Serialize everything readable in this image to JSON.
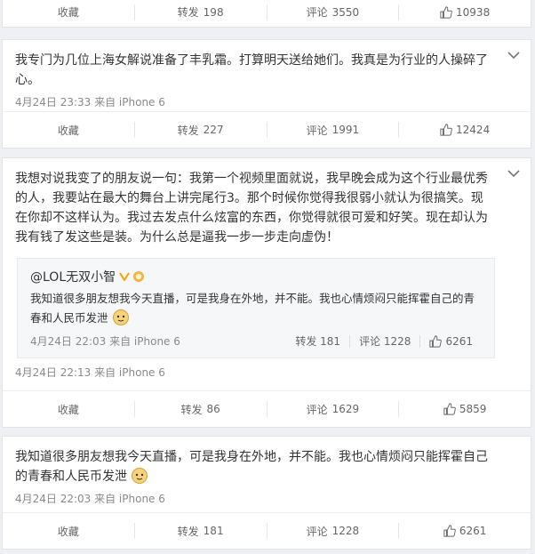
{
  "posts": [
    {
      "actions": {
        "collect": "收藏",
        "repost_label": "转发",
        "repost_count": "198",
        "comment_label": "评论",
        "comment_count": "3550",
        "like_count": "10938"
      }
    },
    {
      "text": "我专门为几位上海女解说准备了丰乳霜。打算明天送给她们。我真是为行业的人操碎了心。",
      "meta": "4月24日 23:33 来自 iPhone 6",
      "actions": {
        "collect": "收藏",
        "repost_label": "转发",
        "repost_count": "227",
        "comment_label": "评论",
        "comment_count": "1991",
        "like_count": "12424"
      }
    },
    {
      "text": "我想对说我变了的朋友说一句：我第一个视频里面就说，我早晚会成为这个行业最优秀的人，我要站在最大的舞台上讲完尾行3。那个时候你觉得我很弱小就认为很搞笑。现在你却不这样认为。我过去发点什么炫富的东西，你觉得就很可爱和好笑。现在却认为我有钱了发这些是装。为什么总是逼我一步一步走向虚伪！",
      "repost": {
        "user": "@LOL无双小智",
        "text": "我知道很多朋友想我今天直播，可是我身在外地，并不能。我也心情烦闷只能挥霍自己的青春和人民币发泄",
        "meta": "4月24日 22:03 来自 iPhone 6",
        "repost_label": "转发",
        "repost_count": "181",
        "comment_label": "评论",
        "comment_count": "1228",
        "like_count": "6261"
      },
      "meta": "4月24日 22:13 来自 iPhone 6",
      "actions": {
        "collect": "收藏",
        "repost_label": "转发",
        "repost_count": "86",
        "comment_label": "评论",
        "comment_count": "1629",
        "like_count": "5859"
      }
    },
    {
      "text": "我知道很多朋友想我今天直播，可是我身在外地，并不能。我也心情烦闷只能挥霍自己的青春和人民币发泄",
      "meta": "4月24日 22:03 来自 iPhone 6",
      "actions": {
        "collect": "收藏",
        "repost_label": "转发",
        "repost_count": "181",
        "comment_label": "评论",
        "comment_count": "1228",
        "like_count": "6261"
      }
    }
  ],
  "icons": {
    "chevron": "chevron-down-icon",
    "thumb": "thumbs-up-icon",
    "emoji": "dog-face-emoji-icon",
    "verified": "verified-v-icon",
    "coin": "coin-badge-icon"
  },
  "colors": {
    "link": "#eb7350",
    "muted": "#8a8a8a",
    "verified": "#f7a300"
  }
}
